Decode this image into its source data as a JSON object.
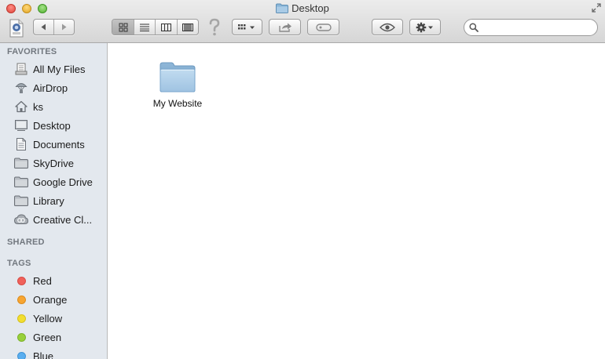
{
  "window": {
    "title": "Desktop"
  },
  "toolbar": {
    "proxy_icon": "ico-file-icon",
    "back_icon": "back-arrow-icon",
    "forward_icon": "forward-arrow-icon",
    "view_modes": [
      "icon-view",
      "list-view",
      "column-view",
      "cover-flow-view"
    ],
    "active_view": "icon-view",
    "help_icon": "question-mark-icon",
    "arrange_icon": "arrange-grid-icon",
    "share_icon": "share-icon",
    "tags_icon": "tag-pill-icon",
    "quicklook_icon": "eye-icon",
    "action_icon": "gear-icon",
    "search_placeholder": ""
  },
  "sidebar": {
    "favorites_header": "FAVORITES",
    "favorites": [
      {
        "label": "All My Files",
        "icon": "all-files-icon"
      },
      {
        "label": "AirDrop",
        "icon": "airdrop-icon"
      },
      {
        "label": "ks",
        "icon": "home-icon"
      },
      {
        "label": "Desktop",
        "icon": "desktop-icon"
      },
      {
        "label": "Documents",
        "icon": "documents-icon"
      },
      {
        "label": "SkyDrive",
        "icon": "folder-icon"
      },
      {
        "label": "Google Drive",
        "icon": "folder-icon"
      },
      {
        "label": "Library",
        "icon": "folder-icon"
      },
      {
        "label": "Creative Cl...",
        "icon": "creative-cloud-icon"
      }
    ],
    "shared_header": "SHARED",
    "tags_header": "TAGS",
    "tags": [
      {
        "label": "Red",
        "color": "#f0615a",
        "border": "#d84b45"
      },
      {
        "label": "Orange",
        "color": "#f7a531",
        "border": "#db8c1e"
      },
      {
        "label": "Yellow",
        "color": "#f2de2f",
        "border": "#d6c11f"
      },
      {
        "label": "Green",
        "color": "#98d03a",
        "border": "#7db22b"
      },
      {
        "label": "Blue",
        "color": "#5aaeef",
        "border": "#3f93d6"
      }
    ]
  },
  "content": {
    "items": [
      {
        "name": "My Website",
        "icon": "folder-icon"
      }
    ]
  }
}
